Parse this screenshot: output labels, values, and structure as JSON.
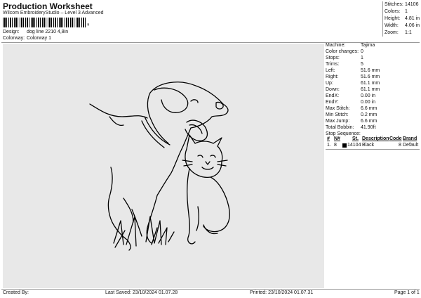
{
  "header": {
    "title": "Production Worksheet",
    "subtitle": "Wilcom EmbroideryStudio – Level 3 Advanced",
    "barcode_suffix": ","
  },
  "meta": {
    "design_label": "Design:",
    "design_value": "dog line 2210 4,8in",
    "colorway_label": "Colorway:",
    "colorway_value": "Colorway 1"
  },
  "stats": [
    {
      "label": "Stitches:",
      "value": "14106"
    },
    {
      "label": "Colors:",
      "value": "1"
    },
    {
      "label": "Height:",
      "value": "4.81 in"
    },
    {
      "label": "Width:",
      "value": "4.06 in"
    },
    {
      "label": "Zoom:",
      "value": "1:1"
    }
  ],
  "properties": [
    {
      "label": "Machine:",
      "value": "Tajima"
    },
    {
      "label": "Color changes:",
      "value": "0"
    },
    {
      "label": "Stops:",
      "value": "1"
    },
    {
      "label": "Trims:",
      "value": "5"
    },
    {
      "label": "Left:",
      "value": "51.6 mm"
    },
    {
      "label": "Right:",
      "value": "51.6 mm"
    },
    {
      "label": "Up:",
      "value": "61.1 mm"
    },
    {
      "label": "Down:",
      "value": "61.1 mm"
    },
    {
      "label": "EndX:",
      "value": "0.00 in"
    },
    {
      "label": "EndY:",
      "value": "0.00 in"
    },
    {
      "label": "Max Stitch:",
      "value": "6.6 mm"
    },
    {
      "label": "Min Stitch:",
      "value": "0.2 mm"
    },
    {
      "label": "Max Jump:",
      "value": "6.6 mm"
    },
    {
      "label": "Total Bobbin:",
      "value": "41.90ft"
    }
  ],
  "stop_sequence": {
    "title": "Stop Sequence:",
    "headers": [
      "#",
      "N#",
      "St.",
      "Description",
      "Code",
      "Brand"
    ],
    "rows": [
      {
        "index": "1.",
        "needle": "8",
        "stitches": "14104",
        "description": "Black",
        "code": "8",
        "brand": "Default",
        "color": "#000000"
      }
    ]
  },
  "footer": {
    "created_by": "Created By:",
    "last_saved": "Last Saved: 23/10/2024 01.07.28",
    "printed": "Printed: 23/10/2024 01.07.31",
    "page": "Page 1 of 1"
  },
  "colors": {
    "canvas_bg": "#e8e8e8",
    "thread": "#000000"
  }
}
